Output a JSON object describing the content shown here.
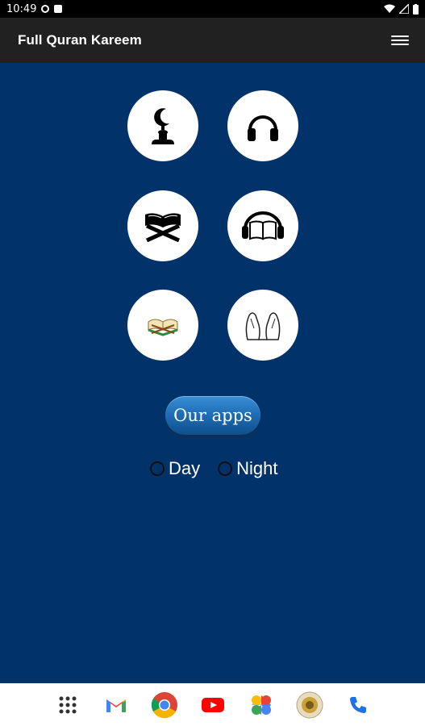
{
  "status_bar": {
    "time": "10:49",
    "left_icons": [
      "do-not-disturb-icon",
      "storage-icon"
    ],
    "right_icons": [
      "wifi-icon",
      "signal-icon",
      "battery-icon"
    ]
  },
  "app_bar": {
    "title": "Full Quran Kareem",
    "menu_icon": "hamburger-menu-icon"
  },
  "grid_items": [
    {
      "name": "mosque-crescent-icon"
    },
    {
      "name": "headphones-icon"
    },
    {
      "name": "quran-stand-icon"
    },
    {
      "name": "audio-quran-icon"
    },
    {
      "name": "open-quran-book-icon"
    },
    {
      "name": "praying-hands-icon"
    }
  ],
  "our_apps_label": "Our apps",
  "theme": {
    "options": [
      {
        "label": "Day",
        "selected": false
      },
      {
        "label": "Night",
        "selected": false
      }
    ]
  },
  "dock": {
    "apps": [
      "app-drawer-icon",
      "gmail-icon",
      "chrome-icon",
      "youtube-icon",
      "photos-icon",
      "quran-app-icon",
      "phone-icon"
    ]
  },
  "colors": {
    "background": "#02326a",
    "app_bar": "#212121",
    "button_accent": "#1f6fb8"
  }
}
